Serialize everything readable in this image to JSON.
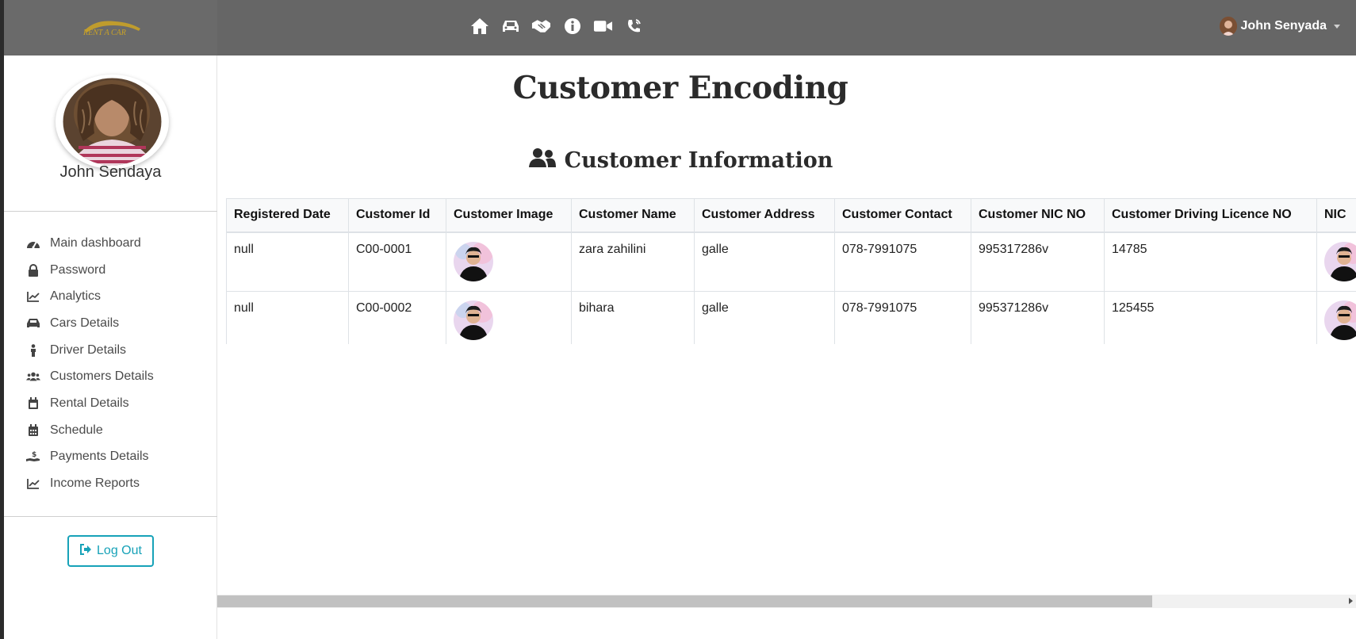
{
  "brand": {
    "logo_text": "RENT A CAR",
    "logo_color": "#c9a227"
  },
  "topbar": {
    "background": "#666666",
    "nav_icons": [
      "home-icon",
      "car-icon",
      "handshake-icon",
      "info-circle-icon",
      "video-icon",
      "phone-volume-icon"
    ],
    "user_name": "John Senyada"
  },
  "sidebar": {
    "profile_name": "John Sendaya",
    "items": [
      {
        "label": "Main dashboard",
        "icon": "tachometer-icon"
      },
      {
        "label": "Password",
        "icon": "lock-icon"
      },
      {
        "label": "Analytics",
        "icon": "chart-line-icon"
      },
      {
        "label": "Cars Details",
        "icon": "car-icon"
      },
      {
        "label": "Driver Details",
        "icon": "person-icon"
      },
      {
        "label": "Customers Details",
        "icon": "users-icon"
      },
      {
        "label": "Rental Details",
        "icon": "calendar-icon"
      },
      {
        "label": "Schedule",
        "icon": "calendar-alt-icon"
      },
      {
        "label": "Payments Details",
        "icon": "hand-holding-dollar-icon"
      },
      {
        "label": "Income Reports",
        "icon": "chart-line-icon"
      }
    ],
    "logout_label": "Log Out",
    "accent": "#17a2b8"
  },
  "main": {
    "page_title": "Customer Encoding",
    "section_title": "Customer Information",
    "table": {
      "columns": [
        "Registered Date",
        "Customer Id",
        "Customer Image",
        "Customer Name",
        "Customer Address",
        "Customer Contact",
        "Customer NIC NO",
        "Customer Driving Licence NO",
        "NIC"
      ],
      "rows": [
        [
          "null",
          "C00-0001",
          "",
          "zara zahilini",
          "galle",
          "078-7991075",
          "995317286v",
          "14785",
          ""
        ],
        [
          "null",
          "C00-0002",
          "",
          "bihara",
          "galle",
          "078-7991075",
          "995371286v",
          "125455",
          ""
        ]
      ]
    }
  }
}
